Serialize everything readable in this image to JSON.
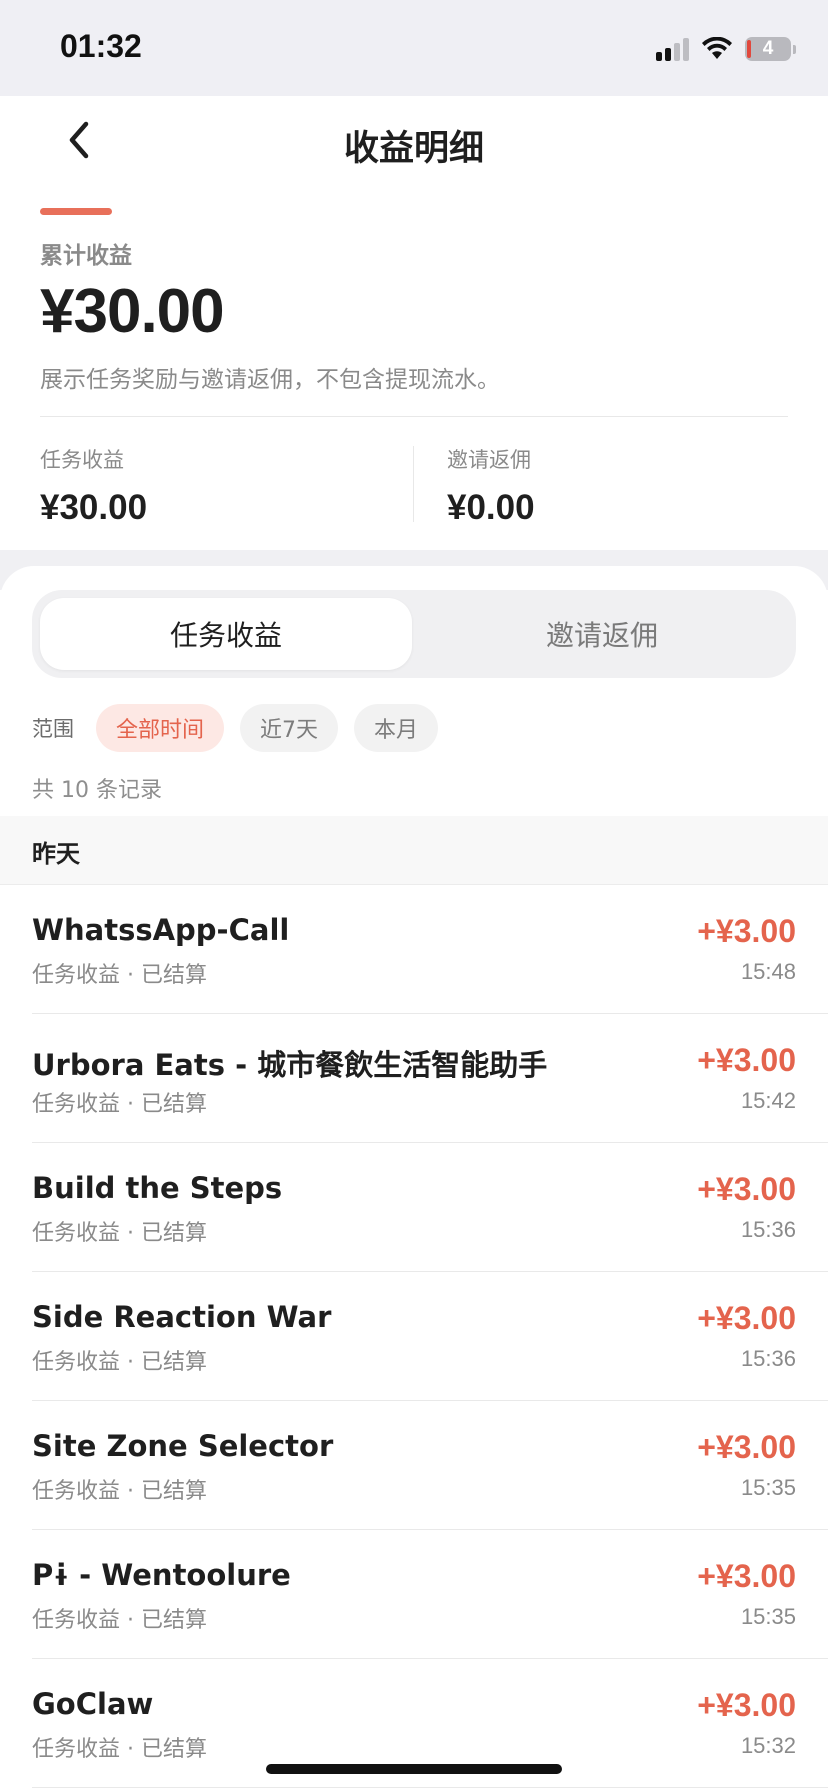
{
  "status_bar": {
    "time": "01:32",
    "battery": "4"
  },
  "nav": {
    "title": "收益明细",
    "back_icon": "chevron-left-icon"
  },
  "summary": {
    "total_label": "累计收益",
    "total_amount": "¥30.00",
    "description": "展示任务奖励与邀请返佣，不包含提现流水。",
    "task_label": "任务收益",
    "task_value": "¥30.00",
    "invite_label": "邀请返佣",
    "invite_value": "¥0.00"
  },
  "tabs": [
    {
      "label": "任务收益",
      "active": true
    },
    {
      "label": "邀请返佣",
      "active": false
    }
  ],
  "filters": {
    "label": "范围",
    "chips": [
      {
        "label": "全部时间",
        "active": true
      },
      {
        "label": "近7天",
        "active": false
      },
      {
        "label": "本月",
        "active": false
      }
    ]
  },
  "record_count": "共 10 条记录",
  "group_label": "昨天",
  "records": [
    {
      "title": "WhatssApp-Call",
      "subtitle": "任务收益 · 已结算",
      "amount": "+¥3.00",
      "time": "15:48"
    },
    {
      "title": "Urbora Eats - 城市餐飲生活智能助手",
      "subtitle": "任务收益 · 已结算",
      "amount": "+¥3.00",
      "time": "15:42"
    },
    {
      "title": "Build the Steps",
      "subtitle": "任务收益 · 已结算",
      "amount": "+¥3.00",
      "time": "15:36"
    },
    {
      "title": "Side Reaction War",
      "subtitle": "任务收益 · 已结算",
      "amount": "+¥3.00",
      "time": "15:36"
    },
    {
      "title": "Site Zone Selector",
      "subtitle": "任务收益 · 已结算",
      "amount": "+¥3.00",
      "time": "15:35"
    },
    {
      "title": "Pɨ - Wentoolure",
      "subtitle": "任务收益 · 已结算",
      "amount": "+¥3.00",
      "time": "15:35"
    },
    {
      "title": "GoClaw",
      "subtitle": "任务收益 · 已结算",
      "amount": "+¥3.00",
      "time": "15:32"
    }
  ],
  "colors": {
    "accent": "#e4644d",
    "accent_bg": "#fde8e4",
    "text": "#1f1f1f",
    "muted": "#8a8a8a"
  }
}
